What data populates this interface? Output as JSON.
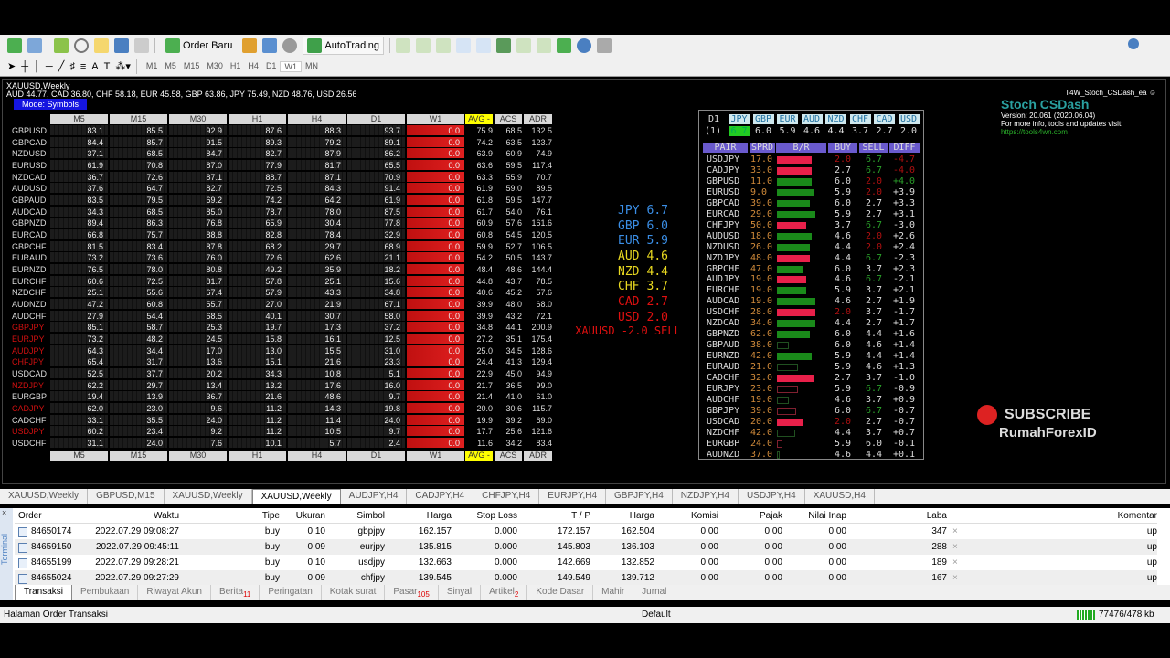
{
  "toolbar": {
    "order_label": "Order Baru",
    "autotrading_label": "AutoTrading",
    "timeframes": [
      "M1",
      "M5",
      "M15",
      "M30",
      "H1",
      "H4",
      "D1",
      "W1",
      "MN"
    ],
    "active_tf": "W1"
  },
  "chart": {
    "symbol": "XAUUSD,Weekly",
    "strength_line": "AUD 44.77, CAD 36.80, CHF 58.18, EUR 45.58, GBP 63.86, JPY 75.49, NZD 48.76, USD 26.56",
    "mode": "Mode: Symbols",
    "columns": [
      "M5",
      "M15",
      "M30",
      "H1",
      "H4",
      "D1",
      "W1",
      "AVG -",
      "ACS",
      "ADR"
    ],
    "rows": [
      {
        "s": "GBPUSD",
        "v": [
          "83.1",
          "85.5",
          "92.9",
          "87.6",
          "88.3",
          "93.7",
          "0.0",
          "75.9",
          "68.5",
          "132.5"
        ]
      },
      {
        "s": "GBPCAD",
        "v": [
          "84.4",
          "85.7",
          "91.5",
          "89.3",
          "79.2",
          "89.1",
          "0.0",
          "74.2",
          "63.5",
          "123.7"
        ]
      },
      {
        "s": "NZDUSD",
        "v": [
          "37.1",
          "68.5",
          "84.7",
          "82.7",
          "87.9",
          "86.2",
          "0.0",
          "63.9",
          "60.9",
          "74.9"
        ]
      },
      {
        "s": "EURUSD",
        "v": [
          "61.9",
          "70.8",
          "87.0",
          "77.9",
          "81.7",
          "65.5",
          "0.0",
          "63.6",
          "59.5",
          "117.4"
        ]
      },
      {
        "s": "NZDCAD",
        "v": [
          "36.7",
          "72.6",
          "87.1",
          "88.7",
          "87.1",
          "70.9",
          "0.0",
          "63.3",
          "55.9",
          "70.7"
        ]
      },
      {
        "s": "AUDUSD",
        "v": [
          "37.6",
          "64.7",
          "82.7",
          "72.5",
          "84.3",
          "91.4",
          "0.0",
          "61.9",
          "59.0",
          "89.5"
        ]
      },
      {
        "s": "GBPAUD",
        "v": [
          "83.5",
          "79.5",
          "69.2",
          "74.2",
          "64.2",
          "61.9",
          "0.0",
          "61.8",
          "59.5",
          "147.7"
        ]
      },
      {
        "s": "AUDCAD",
        "v": [
          "34.3",
          "68.5",
          "85.0",
          "78.7",
          "78.0",
          "87.5",
          "0.0",
          "61.7",
          "54.0",
          "76.1"
        ]
      },
      {
        "s": "GBPNZD",
        "v": [
          "89.4",
          "86.3",
          "76.8",
          "65.9",
          "30.4",
          "77.8",
          "0.0",
          "60.9",
          "57.6",
          "161.6"
        ]
      },
      {
        "s": "EURCAD",
        "v": [
          "66.8",
          "75.7",
          "88.8",
          "82.8",
          "78.4",
          "32.9",
          "0.0",
          "60.8",
          "54.5",
          "120.5"
        ]
      },
      {
        "s": "GBPCHF",
        "v": [
          "81.5",
          "83.4",
          "87.8",
          "68.2",
          "29.7",
          "68.9",
          "0.0",
          "59.9",
          "52.7",
          "106.5"
        ]
      },
      {
        "s": "EURAUD",
        "v": [
          "73.2",
          "73.6",
          "76.0",
          "72.6",
          "62.6",
          "21.1",
          "0.0",
          "54.2",
          "50.5",
          "143.7"
        ]
      },
      {
        "s": "EURNZD",
        "v": [
          "76.5",
          "78.0",
          "80.8",
          "49.2",
          "35.9",
          "18.2",
          "0.0",
          "48.4",
          "48.6",
          "144.4"
        ]
      },
      {
        "s": "EURCHF",
        "v": [
          "60.6",
          "72.5",
          "81.7",
          "57.8",
          "25.1",
          "15.6",
          "0.0",
          "44.8",
          "43.7",
          "78.5"
        ]
      },
      {
        "s": "NZDCHF",
        "v": [
          "25.1",
          "55.6",
          "67.4",
          "57.9",
          "43.3",
          "34.8",
          "0.0",
          "40.6",
          "45.2",
          "57.6"
        ]
      },
      {
        "s": "AUDNZD",
        "v": [
          "47.2",
          "60.8",
          "55.7",
          "27.0",
          "21.9",
          "67.1",
          "0.0",
          "39.9",
          "48.0",
          "68.0"
        ]
      },
      {
        "s": "AUDCHF",
        "v": [
          "27.9",
          "54.4",
          "68.5",
          "40.1",
          "30.7",
          "58.0",
          "0.0",
          "39.9",
          "43.2",
          "72.1"
        ]
      },
      {
        "s": "GBPJPY",
        "red": true,
        "v": [
          "85.1",
          "58.7",
          "25.3",
          "19.7",
          "17.3",
          "37.2",
          "0.0",
          "34.8",
          "44.1",
          "200.9"
        ]
      },
      {
        "s": "EURJPY",
        "red": true,
        "v": [
          "73.2",
          "48.2",
          "24.5",
          "15.8",
          "16.1",
          "12.5",
          "0.0",
          "27.2",
          "35.1",
          "175.4"
        ]
      },
      {
        "s": "AUDJPY",
        "red": true,
        "v": [
          "64.3",
          "34.4",
          "17.0",
          "13.0",
          "15.5",
          "31.0",
          "0.0",
          "25.0",
          "34.5",
          "128.6"
        ]
      },
      {
        "s": "CHFJPY",
        "red": true,
        "v": [
          "65.4",
          "31.7",
          "13.6",
          "15.1",
          "21.6",
          "23.3",
          "0.0",
          "24.4",
          "41.3",
          "129.4"
        ]
      },
      {
        "s": "USDCAD",
        "v": [
          "52.5",
          "37.7",
          "20.2",
          "34.3",
          "10.8",
          "5.1",
          "0.0",
          "22.9",
          "45.0",
          "94.9"
        ]
      },
      {
        "s": "NZDJPY",
        "red": true,
        "v": [
          "62.2",
          "29.7",
          "13.4",
          "13.2",
          "17.6",
          "16.0",
          "0.0",
          "21.7",
          "36.5",
          "99.0"
        ]
      },
      {
        "s": "EURGBP",
        "v": [
          "19.4",
          "13.9",
          "36.7",
          "21.6",
          "48.6",
          "9.7",
          "0.0",
          "21.4",
          "41.0",
          "61.0"
        ]
      },
      {
        "s": "CADJPY",
        "red": true,
        "v": [
          "62.0",
          "23.0",
          "9.6",
          "11.2",
          "14.3",
          "19.8",
          "0.0",
          "20.0",
          "30.6",
          "115.7"
        ]
      },
      {
        "s": "CADCHF",
        "v": [
          "33.1",
          "35.5",
          "24.0",
          "11.2",
          "11.4",
          "24.0",
          "0.0",
          "19.9",
          "39.2",
          "69.0"
        ]
      },
      {
        "s": "USDJPY",
        "red": true,
        "v": [
          "60.2",
          "23.4",
          "9.2",
          "11.2",
          "10.5",
          "9.7",
          "0.0",
          "17.7",
          "25.6",
          "121.6"
        ]
      },
      {
        "s": "USDCHF",
        "v": [
          "31.1",
          "24.0",
          "7.6",
          "10.1",
          "5.7",
          "2.4",
          "0.0",
          "11.6",
          "34.2",
          "83.4"
        ]
      }
    ],
    "strength": [
      {
        "c": "JPY",
        "v": "6.7",
        "col": "#3a8ee6"
      },
      {
        "c": "GBP",
        "v": "6.0",
        "col": "#3a8ee6"
      },
      {
        "c": "EUR",
        "v": "5.9",
        "col": "#3a8ee6"
      },
      {
        "c": "AUD",
        "v": "4.6",
        "col": "#e8d820"
      },
      {
        "c": "NZD",
        "v": "4.4",
        "col": "#e8d820"
      },
      {
        "c": "CHF",
        "v": "3.7",
        "col": "#e8d820"
      },
      {
        "c": "CAD",
        "v": "2.7",
        "col": "#e01010"
      },
      {
        "c": "USD",
        "v": "2.0",
        "col": "#e01010"
      }
    ],
    "signal": "XAUUSD -2.0 SELL"
  },
  "panel": {
    "tf": "D1",
    "idx": "(1)",
    "currencies": [
      "JPY",
      "GBP",
      "EUR",
      "AUD",
      "NZD",
      "CHF",
      "CAD",
      "USD"
    ],
    "values": [
      "6.7",
      "6.0",
      "5.9",
      "4.6",
      "4.4",
      "3.7",
      "2.7",
      "2.0"
    ],
    "headers": [
      "PAIR",
      "SPRD",
      "B/R",
      "BUY",
      "SELL",
      "DIFF"
    ],
    "rows": [
      [
        "USDJPY",
        "17.0",
        -0.9,
        true,
        "2.0",
        "6.7",
        "-4.7"
      ],
      [
        "CADJPY",
        "33.0",
        -0.9,
        true,
        "2.7",
        "6.7",
        "-4.0"
      ],
      [
        "GBPUSD",
        "11.0",
        0.9,
        true,
        "6.0",
        "2.0",
        "+4.0"
      ],
      [
        "EURUSD",
        "9.0",
        0.95,
        true,
        "5.9",
        "2.0",
        "+3.9"
      ],
      [
        "GBPCAD",
        "39.0",
        0.85,
        true,
        "6.0",
        "2.7",
        "+3.3"
      ],
      [
        "EURCAD",
        "29.0",
        1.0,
        true,
        "5.9",
        "2.7",
        "+3.1"
      ],
      [
        "CHFJPY",
        "50.0",
        -0.75,
        true,
        "3.7",
        "6.7",
        "-3.0"
      ],
      [
        "AUDUSD",
        "18.0",
        0.9,
        true,
        "4.6",
        "2.0",
        "+2.6"
      ],
      [
        "NZDUSD",
        "26.0",
        0.85,
        true,
        "4.4",
        "2.0",
        "+2.4"
      ],
      [
        "NZDJPY",
        "48.0",
        -0.85,
        true,
        "4.4",
        "6.7",
        "-2.3"
      ],
      [
        "GBPCHF",
        "47.0",
        0.7,
        true,
        "6.0",
        "3.7",
        "+2.3"
      ],
      [
        "AUDJPY",
        "19.0",
        -0.75,
        true,
        "4.6",
        "6.7",
        "-2.1"
      ],
      [
        "EURCHF",
        "19.0",
        0.75,
        true,
        "5.9",
        "3.7",
        "+2.1"
      ],
      [
        "AUDCAD",
        "19.0",
        1.0,
        true,
        "4.6",
        "2.7",
        "+1.9"
      ],
      [
        "USDCHF",
        "28.0",
        -1.0,
        true,
        "2.0",
        "3.7",
        "-1.7"
      ],
      [
        "NZDCAD",
        "34.0",
        1.0,
        true,
        "4.4",
        "2.7",
        "+1.7"
      ],
      [
        "GBPNZD",
        "62.0",
        0.85,
        true,
        "6.0",
        "4.4",
        "+1.6"
      ],
      [
        "GBPAUD",
        "38.0",
        0.3,
        false,
        "6.0",
        "4.6",
        "+1.4"
      ],
      [
        "EURNZD",
        "42.0",
        0.9,
        true,
        "5.9",
        "4.4",
        "+1.4"
      ],
      [
        "EURAUD",
        "21.0",
        0.55,
        false,
        "5.9",
        "4.6",
        "+1.3"
      ],
      [
        "CADCHF",
        "32.0",
        -0.95,
        true,
        "2.7",
        "3.7",
        "-1.0"
      ],
      [
        "EURJPY",
        "23.0",
        -0.55,
        false,
        "5.9",
        "6.7",
        "-0.9"
      ],
      [
        "AUDCHF",
        "19.0",
        0.3,
        false,
        "4.6",
        "3.7",
        "+0.9"
      ],
      [
        "GBPJPY",
        "39.0",
        -0.5,
        false,
        "6.0",
        "6.7",
        "-0.7"
      ],
      [
        "USDCAD",
        "20.0",
        -0.67,
        true,
        "2.0",
        "2.7",
        "-0.7"
      ],
      [
        "NZDCHF",
        "42.0",
        0.48,
        false,
        "4.4",
        "3.7",
        "+0.7"
      ],
      [
        "EURGBP",
        "24.0",
        -0.15,
        false,
        "5.9",
        "6.0",
        "-0.1"
      ],
      [
        "AUDNZD",
        "37.0",
        0.05,
        false,
        "4.6",
        "4.4",
        "+0.1"
      ]
    ]
  },
  "ea": {
    "name": "T4W_Stoch_CSDash_ea",
    "title": "Stoch CSDash",
    "version": "Version: 20.061 (2020.06.04)",
    "info": "For more info, tools and updates visit:",
    "url": "https://tools4wn.com"
  },
  "subscribe": {
    "label": "SUBSCRIBE",
    "channel": "RumahForexID"
  },
  "chart_tabs": [
    "XAUUSD,Weekly",
    "GBPUSD,M15",
    "XAUUSD,Weekly",
    "XAUUSD,Weekly",
    "AUDJPY,H4",
    "CADJPY,H4",
    "CHFJPY,H4",
    "EURJPY,H4",
    "GBPJPY,H4",
    "NZDJPY,H4",
    "USDJPY,H4",
    "XAUUSD,H4"
  ],
  "terminal": {
    "side_label": "Terminal",
    "columns": [
      "Order",
      "Waktu",
      "Tipe",
      "Ukuran",
      "Simbol",
      "Harga",
      "Stop Loss",
      "T / P",
      "Harga",
      "Komisi",
      "Pajak",
      "Nilai Inap",
      "Laba",
      "Komentar"
    ],
    "rows": [
      [
        "84650174",
        "2022.07.29 09:08:27",
        "buy",
        "0.10",
        "gbpjpy",
        "162.157",
        "0.000",
        "172.157",
        "162.504",
        "0.00",
        "0.00",
        "0.00",
        "347",
        "up"
      ],
      [
        "84659150",
        "2022.07.29 09:45:11",
        "buy",
        "0.09",
        "eurjpy",
        "135.815",
        "0.000",
        "145.803",
        "136.103",
        "0.00",
        "0.00",
        "0.00",
        "288",
        "up"
      ],
      [
        "84655199",
        "2022.07.29 09:28:21",
        "buy",
        "0.10",
        "usdjpy",
        "132.663",
        "0.000",
        "142.669",
        "132.852",
        "0.00",
        "0.00",
        "0.00",
        "189",
        "up"
      ],
      [
        "84655024",
        "2022.07.29 09:27:29",
        "buy",
        "0.09",
        "chfjpy",
        "139.545",
        "0.000",
        "149.549",
        "139.712",
        "0.00",
        "0.00",
        "0.00",
        "167",
        "up"
      ]
    ],
    "tabs": [
      {
        "l": "Transaksi"
      },
      {
        "l": "Pembukaan"
      },
      {
        "l": "Riwayat Akun"
      },
      {
        "l": "Berita",
        "b": "11"
      },
      {
        "l": "Peringatan"
      },
      {
        "l": "Kotak surat"
      },
      {
        "l": "Pasar",
        "b": "105"
      },
      {
        "l": "Sinyal"
      },
      {
        "l": "Artikel",
        "b": "2"
      },
      {
        "l": "Kode Dasar"
      },
      {
        "l": "Mahir"
      },
      {
        "l": "Jurnal"
      }
    ]
  },
  "status": {
    "left": "Halaman Order Transaksi",
    "profile": "Default",
    "traffic": "77476/478 kb"
  }
}
